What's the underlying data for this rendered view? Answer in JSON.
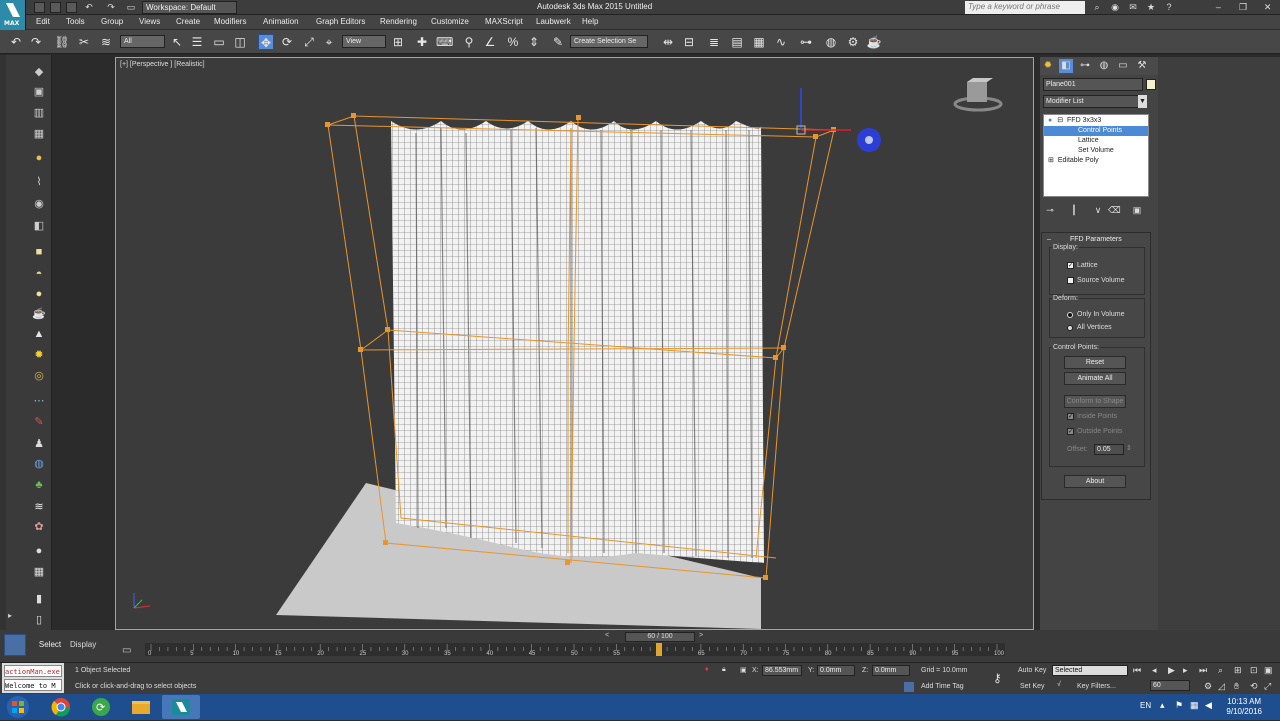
{
  "app": {
    "title": "Autodesk 3ds Max 2015    Untitled",
    "logo_text": "MAX",
    "workspace": "Workspace: Default",
    "search_placeholder": "Type a keyword or phrase"
  },
  "menu": [
    "Edit",
    "Tools",
    "Group",
    "Views",
    "Create",
    "Modifiers",
    "Animation",
    "Graph Editors",
    "Rendering",
    "Customize",
    "MAXScript",
    "Laubwerk",
    "Help"
  ],
  "toolbar": {
    "filter": "All",
    "ref_coord": "View",
    "named_selection": "Create Selection Se"
  },
  "viewport": {
    "label": "[+] [Perspective ] [Realistic]"
  },
  "command_panel": {
    "object_name": "Plane001",
    "object_color": "#f4f2cc",
    "modifier_list": "Modifier List",
    "stack": [
      {
        "label": "FFD 3x3x3",
        "indent": 0,
        "selected": false
      },
      {
        "label": "Control Points",
        "indent": 1,
        "selected": true
      },
      {
        "label": "Lattice",
        "indent": 1,
        "selected": false
      },
      {
        "label": "Set Volume",
        "indent": 1,
        "selected": false
      },
      {
        "label": "Editable Poly",
        "indent": 0,
        "selected": false
      }
    ]
  },
  "ffd": {
    "title": "FFD Parameters",
    "display_label": "Display:",
    "lattice": "Lattice",
    "source_volume": "Source Volume",
    "deform_label": "Deform:",
    "only_in_volume": "Only In Volume",
    "all_vertices": "All Vertices",
    "control_points_label": "Control Points:",
    "reset": "Reset",
    "animate_all": "Animate All",
    "conform": "Conform to Shape",
    "inside_points": "Inside Points",
    "outside_points": "Outside Points",
    "offset_label": "Offset:",
    "offset_value": "0.05",
    "about": "About"
  },
  "bottom": {
    "tab_select": "Select",
    "tab_display": "Display",
    "frame_counter": "60 / 100",
    "ticks": [
      "0",
      "5",
      "10",
      "15",
      "20",
      "25",
      "30",
      "35",
      "40",
      "45",
      "50",
      "55",
      "60",
      "65",
      "70",
      "75",
      "80",
      "85",
      "90",
      "95",
      "100"
    ],
    "maxscript_1": "actionMan.exe",
    "maxscript_2": "Welcome to M",
    "status_selected": "1 Object Selected",
    "status_prompt": "Click or click-and-drag to select objects",
    "x_label": "X:",
    "x_value": "86.553mm",
    "y_label": "Y:",
    "y_value": "0.0mm",
    "z_label": "Z:",
    "z_value": "0.0mm",
    "grid": "Grid = 10.0mm",
    "add_time_tag": "Add Time Tag",
    "auto_key": "Auto Key",
    "set_key": "Set Key",
    "key_mode": "Selected",
    "key_filters": "Key Filters...",
    "frame_field": "60"
  },
  "taskbar": {
    "lang": "EN",
    "time": "10:13 AM",
    "date": "9/10/2016"
  }
}
